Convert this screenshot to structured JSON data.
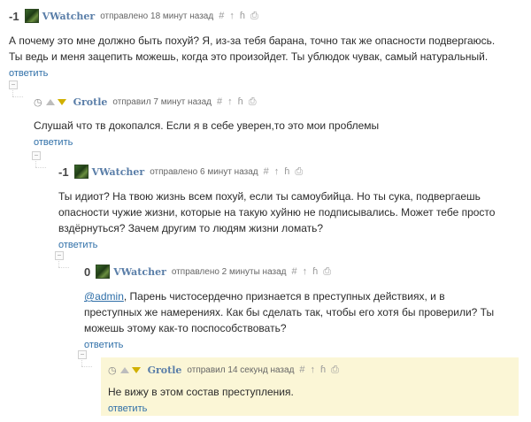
{
  "comments": [
    {
      "score": "-1",
      "author": "VWatcher",
      "action": "отправлено 18 минут назад",
      "text": "А почему это мне должно быть похуй? Я, из-за тебя барана, точно так же опасности подвергаюсь. Ты ведь и меня зацепить можешь, когда это произойдет. Ты ублюдок чувак, самый натуральный.",
      "reply": "ответить"
    },
    {
      "author": "Grotle",
      "action": "отправил 7 минут назад",
      "text": "Слушай что тв докопался. Если я в себе уверен,то это мои проблемы",
      "reply": "ответить"
    },
    {
      "score": "-1",
      "author": "VWatcher",
      "action": "отправлено 6 минут назад",
      "text": "Ты идиот? На твою жизнь всем похуй, если ты самоубийца. Но ты сука, подвергаешь опасности чужие жизни, которые на такую хуйню не подписывались. Может тебе просто вздёрнуться? Зачем другим то людям жизни ломать?",
      "reply": "ответить"
    },
    {
      "score": "0",
      "author": "VWatcher",
      "action": "отправлено 2 минуты назад",
      "mention": "@admin",
      "text": ", Парень чистосердечно признается в преступных действиях, и в преступных же намерениях. Как бы сделать так, чтобы его хотя бы проверили? Ты можешь этому как-то поспособствовать?",
      "reply": "ответить"
    },
    {
      "author": "Grotle",
      "action": "отправил 14 секунд назад",
      "text": "Не вижу в этом состав преступления.",
      "reply": "ответить"
    }
  ],
  "icons": {
    "hash": "#",
    "up": "↑",
    "thread": "ɦ",
    "save": "⎙",
    "clock": "◷"
  },
  "colors": {
    "author": "#5a7ea8",
    "link": "#2f6fa8",
    "highlight": "#fbf6d6",
    "vote_down": "#d1b000"
  }
}
